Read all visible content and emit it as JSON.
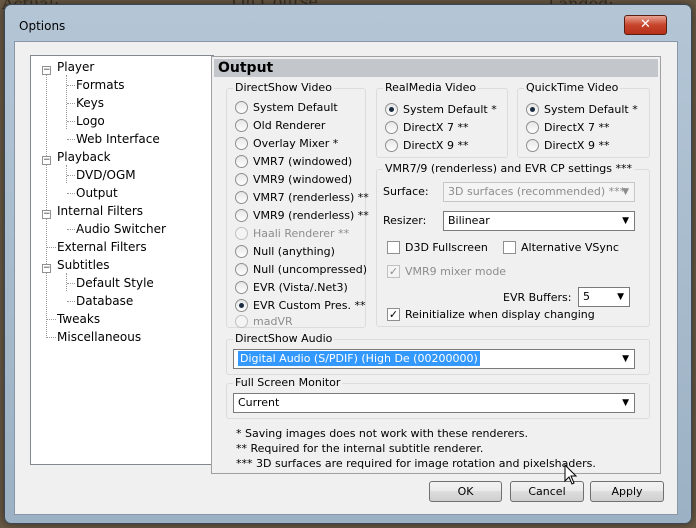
{
  "window": {
    "title": "Options",
    "close_glyph": "✕"
  },
  "background_text": {
    "actual": "Actual:",
    "landed": "Landed:",
    "course": "On Course"
  },
  "tree": {
    "items": [
      {
        "label": "Player",
        "toggle": "−"
      },
      {
        "label": "Formats"
      },
      {
        "label": "Keys"
      },
      {
        "label": "Logo"
      },
      {
        "label": "Web Interface"
      },
      {
        "label": "Playback",
        "toggle": "−"
      },
      {
        "label": "DVD/OGM"
      },
      {
        "label": "Output"
      },
      {
        "label": "Internal Filters",
        "toggle": "−"
      },
      {
        "label": "Audio Switcher"
      },
      {
        "label": "External Filters"
      },
      {
        "label": "Subtitles",
        "toggle": "−"
      },
      {
        "label": "Default Style"
      },
      {
        "label": "Database"
      },
      {
        "label": "Tweaks"
      },
      {
        "label": "Miscellaneous"
      }
    ]
  },
  "page": {
    "header": "Output",
    "directshow_video": {
      "legend": "DirectShow Video",
      "options": [
        {
          "label": "System Default",
          "state": "off"
        },
        {
          "label": "Old Renderer",
          "state": "off"
        },
        {
          "label": "Overlay Mixer *",
          "state": "off"
        },
        {
          "label": "VMR7 (windowed)",
          "state": "off"
        },
        {
          "label": "VMR9 (windowed)",
          "state": "off"
        },
        {
          "label": "VMR7 (renderless) **",
          "state": "off"
        },
        {
          "label": "VMR9 (renderless) **",
          "state": "off"
        },
        {
          "label": "Haali Renderer **",
          "state": "disabled"
        },
        {
          "label": "Null (anything)",
          "state": "off"
        },
        {
          "label": "Null (uncompressed)",
          "state": "off"
        },
        {
          "label": "EVR (Vista/.Net3)",
          "state": "off"
        },
        {
          "label": "EVR Custom Pres. **",
          "state": "on"
        },
        {
          "label": "madVR",
          "state": "disabled"
        }
      ]
    },
    "realmedia_video": {
      "legend": "RealMedia Video",
      "options": [
        {
          "label": "System Default *",
          "state": "on"
        },
        {
          "label": "DirectX 7 **",
          "state": "off"
        },
        {
          "label": "DirectX 9 **",
          "state": "off"
        }
      ]
    },
    "quicktime_video": {
      "legend": "QuickTime Video",
      "options": [
        {
          "label": "System Default *",
          "state": "on"
        },
        {
          "label": "DirectX 7 **",
          "state": "off"
        },
        {
          "label": "DirectX 9 **",
          "state": "off"
        }
      ]
    },
    "vmr_settings": {
      "legend": "VMR7/9 (renderless) and EVR CP settings ***",
      "surface_label": "Surface:",
      "surface_value": "3D surfaces (recommended) ***",
      "resizer_label": "Resizer:",
      "resizer_value": "Bilinear",
      "d3d_fullscreen": "D3D Fullscreen",
      "alternative_vsync": "Alternative VSync",
      "vmr9_mixer_mode": "VMR9 mixer mode",
      "evr_buffers_label": "EVR Buffers:",
      "evr_buffers_value": "5",
      "reinitialize": "Reinitialize when display changing"
    },
    "directshow_audio": {
      "legend": "DirectShow Audio",
      "value": "Digital Audio (S/PDIF) (High De (00200000)"
    },
    "full_screen_monitor": {
      "legend": "Full Screen Monitor",
      "value": "Current"
    },
    "notes": [
      "* Saving images does not work with these renderers.",
      "** Required for the internal subtitle renderer.",
      "*** 3D surfaces are required for image rotation and pixelshaders."
    ]
  },
  "buttons": {
    "ok": "OK",
    "cancel": "Cancel",
    "apply": "Apply"
  },
  "glyphs": {
    "dropdown": "▼",
    "checkmark": "✓",
    "cursor": "mouse-cursor-icon"
  }
}
